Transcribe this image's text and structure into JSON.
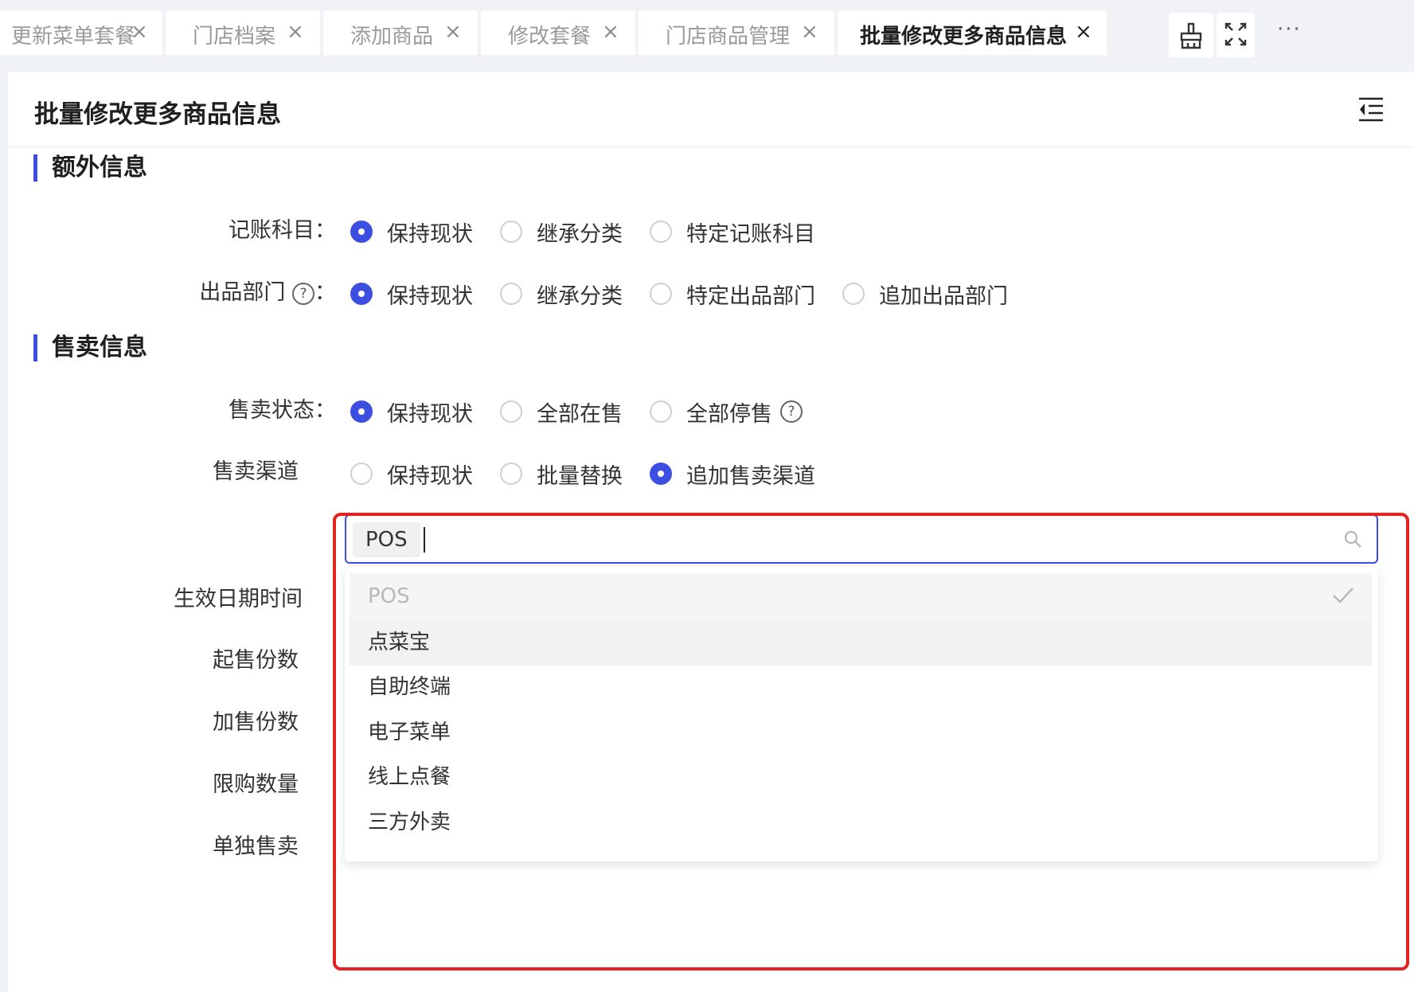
{
  "tabs": [
    {
      "label": "更新菜单套餐",
      "active": false
    },
    {
      "label": "门店档案",
      "active": false
    },
    {
      "label": "添加商品",
      "active": false
    },
    {
      "label": "修改套餐",
      "active": false
    },
    {
      "label": "门店商品管理",
      "active": false
    },
    {
      "label": "批量修改更多商品信息",
      "active": true
    }
  ],
  "tab_close": "×",
  "tab_more": "···",
  "page_title": "批量修改更多商品信息",
  "sections": {
    "extra": "额外信息",
    "sales": "售卖信息"
  },
  "fields": {
    "accounting": {
      "label": "记账科目：",
      "options": [
        "保持现状",
        "继承分类",
        "特定记账科目"
      ],
      "selected": 0
    },
    "dept": {
      "label": "出品部门",
      "help": "?",
      "colon": "：",
      "options": [
        "保持现状",
        "继承分类",
        "特定出品部门",
        "追加出品部门"
      ],
      "selected": 0
    },
    "sale_status": {
      "label": "售卖状态：",
      "options": [
        "保持现状",
        "全部在售",
        "全部停售"
      ],
      "selected": 0,
      "help": "?"
    },
    "sale_channel": {
      "label": "售卖渠道",
      "options": [
        "保持现状",
        "批量替换",
        "追加售卖渠道"
      ],
      "selected": 2
    },
    "effective_time": {
      "label": "生效日期时间"
    },
    "min_qty": {
      "label": "起售份数"
    },
    "add_qty": {
      "label": "加售份数"
    },
    "limit_qty": {
      "label": "限购数量"
    },
    "single_sale": {
      "label": "单独售卖"
    }
  },
  "channel_select": {
    "tag": "POS",
    "options": [
      "POS",
      "点菜宝",
      "自助终端",
      "电子菜单",
      "线上点餐",
      "三方外卖"
    ],
    "selected_index": 0,
    "hover_index": 1
  },
  "colors": {
    "accent": "#3d4fe0",
    "highlight_border": "#e52222"
  }
}
